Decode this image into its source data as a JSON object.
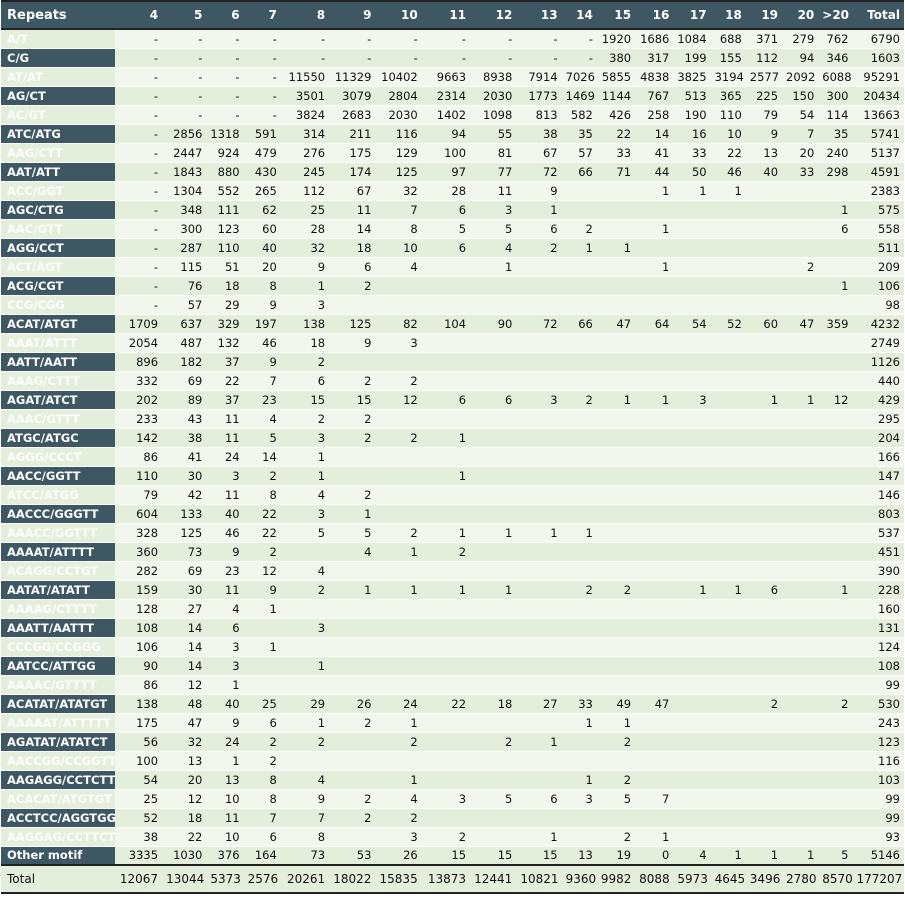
{
  "header": [
    "Repeats",
    "4",
    "5",
    "6",
    "7",
    "8",
    "9",
    "10",
    "11",
    "12",
    "13",
    "14",
    "15",
    "16",
    "17",
    "18",
    "19",
    "20",
    ">20",
    "Total"
  ],
  "rows": [
    [
      "A/T",
      "-",
      "-",
      "-",
      "-",
      "-",
      "-",
      "-",
      "-",
      "-",
      "-",
      "-",
      "1920",
      "1686",
      "1084",
      "688",
      "371",
      "279",
      "762",
      "6790"
    ],
    [
      "C/G",
      "-",
      "-",
      "-",
      "-",
      "-",
      "-",
      "-",
      "-",
      "-",
      "-",
      "-",
      "380",
      "317",
      "199",
      "155",
      "112",
      "94",
      "346",
      "1603"
    ],
    [
      "AT/AT",
      "-",
      "-",
      "-",
      "-",
      "11550",
      "11329",
      "10402",
      "9663",
      "8938",
      "7914",
      "7026",
      "5855",
      "4838",
      "3825",
      "3194",
      "2577",
      "2092",
      "6088",
      "95291"
    ],
    [
      "AG/CT",
      "-",
      "-",
      "-",
      "-",
      "3501",
      "3079",
      "2804",
      "2314",
      "2030",
      "1773",
      "1469",
      "1144",
      "767",
      "513",
      "365",
      "225",
      "150",
      "300",
      "20434"
    ],
    [
      "AC/GT",
      "-",
      "-",
      "-",
      "-",
      "3824",
      "2683",
      "2030",
      "1402",
      "1098",
      "813",
      "582",
      "426",
      "258",
      "190",
      "110",
      "79",
      "54",
      "114",
      "13663"
    ],
    [
      "ATC/ATG",
      "-",
      "2856",
      "1318",
      "591",
      "314",
      "211",
      "116",
      "94",
      "55",
      "38",
      "35",
      "22",
      "14",
      "16",
      "10",
      "9",
      "7",
      "35",
      "5741"
    ],
    [
      "AAG/CTT",
      "-",
      "2447",
      "924",
      "479",
      "276",
      "175",
      "129",
      "100",
      "81",
      "67",
      "57",
      "33",
      "41",
      "33",
      "22",
      "13",
      "20",
      "240",
      "5137"
    ],
    [
      "AAT/ATT",
      "-",
      "1843",
      "880",
      "430",
      "245",
      "174",
      "125",
      "97",
      "77",
      "72",
      "66",
      "71",
      "44",
      "50",
      "46",
      "40",
      "33",
      "298",
      "4591"
    ],
    [
      "ACC/GGT",
      "-",
      "1304",
      "552",
      "265",
      "112",
      "67",
      "32",
      "28",
      "11",
      "9",
      "",
      "",
      "1",
      "1",
      "1",
      "",
      "",
      "",
      "2383"
    ],
    [
      "AGC/CTG",
      "-",
      "348",
      "111",
      "62",
      "25",
      "11",
      "7",
      "6",
      "3",
      "1",
      "",
      "",
      "",
      "",
      "",
      "",
      "",
      "1",
      "575"
    ],
    [
      "AAC/GTT",
      "-",
      "300",
      "123",
      "60",
      "28",
      "14",
      "8",
      "5",
      "5",
      "6",
      "2",
      "",
      "1",
      "",
      "",
      "",
      "",
      "6",
      "558"
    ],
    [
      "AGG/CCT",
      "-",
      "287",
      "110",
      "40",
      "32",
      "18",
      "10",
      "6",
      "4",
      "2",
      "1",
      "1",
      "",
      "",
      "",
      "",
      "",
      "",
      "511"
    ],
    [
      "ACT/AGT",
      "-",
      "115",
      "51",
      "20",
      "9",
      "6",
      "4",
      "",
      "1",
      "",
      "",
      "",
      "1",
      "",
      "",
      "",
      "2",
      "",
      "209"
    ],
    [
      "ACG/CGT",
      "-",
      "76",
      "18",
      "8",
      "1",
      "2",
      "",
      "",
      "",
      "",
      "",
      "",
      "",
      "",
      "",
      "",
      "",
      "1",
      "106"
    ],
    [
      "CCG/CGG",
      "-",
      "57",
      "29",
      "9",
      "3",
      "",
      "",
      "",
      "",
      "",
      "",
      "",
      "",
      "",
      "",
      "",
      "",
      "",
      "98"
    ],
    [
      "ACAT/ATGT",
      "1709",
      "637",
      "329",
      "197",
      "138",
      "125",
      "82",
      "104",
      "90",
      "72",
      "66",
      "47",
      "64",
      "54",
      "52",
      "60",
      "47",
      "359",
      "4232"
    ],
    [
      "AAAT/ATTT",
      "2054",
      "487",
      "132",
      "46",
      "18",
      "9",
      "3",
      "",
      "",
      "",
      "",
      "",
      "",
      "",
      "",
      "",
      "",
      "",
      "2749"
    ],
    [
      "AATT/AATT",
      "896",
      "182",
      "37",
      "9",
      "2",
      "",
      "",
      "",
      "",
      "",
      "",
      "",
      "",
      "",
      "",
      "",
      "",
      "",
      "1126"
    ],
    [
      "AAAG/CTTT",
      "332",
      "69",
      "22",
      "7",
      "6",
      "2",
      "2",
      "",
      "",
      "",
      "",
      "",
      "",
      "",
      "",
      "",
      "",
      "",
      "440"
    ],
    [
      "AGAT/ATCT",
      "202",
      "89",
      "37",
      "23",
      "15",
      "15",
      "12",
      "6",
      "6",
      "3",
      "2",
      "1",
      "1",
      "3",
      "",
      "1",
      "1",
      "12",
      "429"
    ],
    [
      "AAAC/GTTT",
      "233",
      "43",
      "11",
      "4",
      "2",
      "2",
      "",
      "",
      "",
      "",
      "",
      "",
      "",
      "",
      "",
      "",
      "",
      "",
      "295"
    ],
    [
      "ATGC/ATGC",
      "142",
      "38",
      "11",
      "5",
      "3",
      "2",
      "2",
      "1",
      "",
      "",
      "",
      "",
      "",
      "",
      "",
      "",
      "",
      "",
      "204"
    ],
    [
      "AGGG/CCCT",
      "86",
      "41",
      "24",
      "14",
      "1",
      "",
      "",
      "",
      "",
      "",
      "",
      "",
      "",
      "",
      "",
      "",
      "",
      "",
      "166"
    ],
    [
      "AACC/GGTT",
      "110",
      "30",
      "3",
      "2",
      "1",
      "",
      "",
      "1",
      "",
      "",
      "",
      "",
      "",
      "",
      "",
      "",
      "",
      "",
      "147"
    ],
    [
      "ATCC/ATGG",
      "79",
      "42",
      "11",
      "8",
      "4",
      "2",
      "",
      "",
      "",
      "",
      "",
      "",
      "",
      "",
      "",
      "",
      "",
      "",
      "146"
    ],
    [
      "AACCC/GGGTT",
      "604",
      "133",
      "40",
      "22",
      "3",
      "1",
      "",
      "",
      "",
      "",
      "",
      "",
      "",
      "",
      "",
      "",
      "",
      "",
      "803"
    ],
    [
      "AAACC/GGTTT",
      "328",
      "125",
      "46",
      "22",
      "5",
      "5",
      "2",
      "1",
      "1",
      "1",
      "1",
      "",
      "",
      "",
      "",
      "",
      "",
      "",
      "537"
    ],
    [
      "AAAAT/ATTTT",
      "360",
      "73",
      "9",
      "2",
      "",
      "4",
      "1",
      "2",
      "",
      "",
      "",
      "",
      "",
      "",
      "",
      "",
      "",
      "",
      "451"
    ],
    [
      "ACAGG/CCTGT",
      "282",
      "69",
      "23",
      "12",
      "4",
      "",
      "",
      "",
      "",
      "",
      "",
      "",
      "",
      "",
      "",
      "",
      "",
      "",
      "390"
    ],
    [
      "AATAT/ATATT",
      "159",
      "30",
      "11",
      "9",
      "2",
      "1",
      "1",
      "1",
      "1",
      "",
      "2",
      "2",
      "",
      "1",
      "1",
      "6",
      "",
      "1",
      "228"
    ],
    [
      "AAAAG/CTTTT",
      "128",
      "27",
      "4",
      "1",
      "",
      "",
      "",
      "",
      "",
      "",
      "",
      "",
      "",
      "",
      "",
      "",
      "",
      "",
      "160"
    ],
    [
      "AAATT/AATTT",
      "108",
      "14",
      "6",
      "",
      "3",
      "",
      "",
      "",
      "",
      "",
      "",
      "",
      "",
      "",
      "",
      "",
      "",
      "",
      "131"
    ],
    [
      "CCCGG/CCGGG",
      "106",
      "14",
      "3",
      "1",
      "",
      "",
      "",
      "",
      "",
      "",
      "",
      "",
      "",
      "",
      "",
      "",
      "",
      "",
      "124"
    ],
    [
      "AATCC/ATTGG",
      "90",
      "14",
      "3",
      "",
      "1",
      "",
      "",
      "",
      "",
      "",
      "",
      "",
      "",
      "",
      "",
      "",
      "",
      "",
      "108"
    ],
    [
      "AAAAC/GTTTT",
      "86",
      "12",
      "1",
      "",
      "",
      "",
      "",
      "",
      "",
      "",
      "",
      "",
      "",
      "",
      "",
      "",
      "",
      "",
      "99"
    ],
    [
      "ACATAT/ATATGT",
      "138",
      "48",
      "40",
      "25",
      "29",
      "26",
      "24",
      "22",
      "18",
      "27",
      "33",
      "49",
      "47",
      "",
      "",
      "2",
      "",
      "2",
      "530"
    ],
    [
      "AAAAAT/ATTTTT",
      "175",
      "47",
      "9",
      "6",
      "1",
      "2",
      "1",
      "",
      "",
      "",
      "1",
      "1",
      "",
      "",
      "",
      "",
      "",
      "",
      "243"
    ],
    [
      "AGATAT/ATATCT",
      "56",
      "32",
      "24",
      "2",
      "2",
      "",
      "2",
      "",
      "2",
      "1",
      "",
      "2",
      "",
      "",
      "",
      "",
      "",
      "",
      "123"
    ],
    [
      "AACCGG/CCGGTT",
      "100",
      "13",
      "1",
      "2",
      "",
      "",
      "",
      "",
      "",
      "",
      "",
      "",
      "",
      "",
      "",
      "",
      "",
      "",
      "116"
    ],
    [
      "AAGAGG/CCTCTT",
      "54",
      "20",
      "13",
      "8",
      "4",
      "",
      "1",
      "",
      "",
      "",
      "1",
      "2",
      "",
      "",
      "",
      "",
      "",
      "",
      "103"
    ],
    [
      "ACACAT/ATGTGT",
      "25",
      "12",
      "10",
      "8",
      "9",
      "2",
      "4",
      "3",
      "5",
      "6",
      "3",
      "5",
      "7",
      "",
      "",
      "",
      "",
      "",
      "99"
    ],
    [
      "ACCTCC/AGGTGG",
      "52",
      "18",
      "11",
      "7",
      "7",
      "2",
      "2",
      "",
      "",
      "",
      "",
      "",
      "",
      "",
      "",
      "",
      "",
      "",
      "99"
    ],
    [
      "AAGGAG/CCTTCT",
      "38",
      "22",
      "10",
      "6",
      "8",
      "",
      "3",
      "2",
      "",
      "1",
      "",
      "2",
      "1",
      "",
      "",
      "",
      "",
      "",
      "93"
    ],
    [
      "Other motif",
      "3335",
      "1030",
      "376",
      "164",
      "73",
      "53",
      "26",
      "15",
      "15",
      "15",
      "13",
      "19",
      "0",
      "4",
      "1",
      "1",
      "1",
      "5",
      "5146"
    ]
  ],
  "footer": [
    "Total",
    "12067",
    "13044",
    "5373",
    "2576",
    "20261",
    "18022",
    "15835",
    "13873",
    "12441",
    "10821",
    "9360",
    "9982",
    "8088",
    "5973",
    "4645",
    "3496",
    "2780",
    "8570",
    "177207"
  ]
}
